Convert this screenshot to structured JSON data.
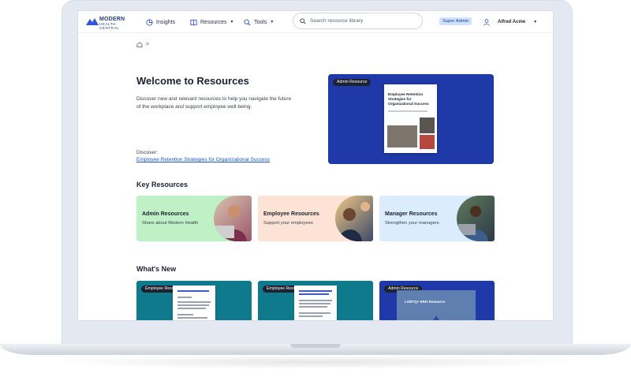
{
  "nav": {
    "logo_line1": "MODERN",
    "logo_line2": "HEALTH CENTRAL",
    "insights": "Insights",
    "resources": "Resources",
    "tools": "Tools",
    "search_placeholder": "Search resource library",
    "role_badge": "Super Admin",
    "user_name": "Alfred Acme"
  },
  "breadcrumb": {
    "separator": ">"
  },
  "hero": {
    "title": "Welcome to Resources",
    "description": "Discover new and relevant resources to help you navigate the future of the workplace and support employee well-being.",
    "discover_label": "Discover:",
    "discover_link": "Employee Retention Strategies for Organizational Success",
    "card_tag": "Admin Resource",
    "doc_title": "Employee Retention Strategies for Organizational Success"
  },
  "key_resources": {
    "title": "Key Resources",
    "cards": [
      {
        "title": "Admin Resources",
        "subtitle": "Share about Modern Health",
        "color": "#bff0c6"
      },
      {
        "title": "Employee Resources",
        "subtitle": "Support your employees",
        "color": "#fde3d6"
      },
      {
        "title": "Manager Resources",
        "subtitle": "Strengthen your managers",
        "color": "#dcecff"
      }
    ]
  },
  "whats_new": {
    "title": "What's New",
    "cards": [
      {
        "tag": "Employee Resource",
        "color": "#0e7a8c"
      },
      {
        "tag": "Employee Resource",
        "color": "#0e7a8c"
      },
      {
        "tag": "Admin Resource",
        "color": "#1f3aa8",
        "doc_title": "LGBTQ+ ERG Resource"
      }
    ]
  }
}
